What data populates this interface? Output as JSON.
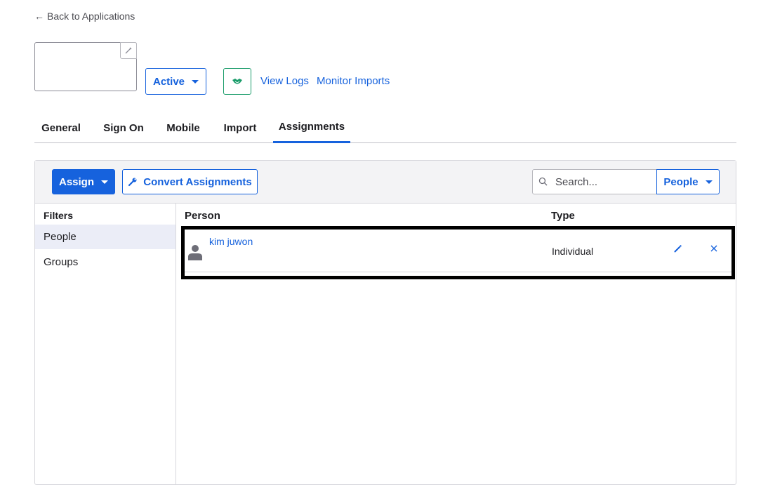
{
  "nav": {
    "back_label": "Back to Applications"
  },
  "app_header": {
    "status": "Active",
    "links": [
      "View Logs",
      "Monitor Imports"
    ]
  },
  "tabs": [
    {
      "label": "General"
    },
    {
      "label": "Sign On"
    },
    {
      "label": "Mobile"
    },
    {
      "label": "Import"
    },
    {
      "label": "Assignments",
      "active": true
    }
  ],
  "toolbar": {
    "assign_label": "Assign",
    "convert_label": "Convert Assignments",
    "search_placeholder": "Search...",
    "search_value": "",
    "filter_type": "People"
  },
  "filters": {
    "title": "Filters",
    "items": [
      {
        "label": "People",
        "selected": true
      },
      {
        "label": "Groups",
        "selected": false
      }
    ]
  },
  "table": {
    "columns": [
      "Person",
      "Type"
    ],
    "rows": [
      {
        "person": "kim juwon",
        "type": "Individual"
      }
    ]
  },
  "colors": {
    "accent": "#1662dd",
    "success": "#1a9c6a",
    "selected_filter_bg": "#ebedf7"
  }
}
